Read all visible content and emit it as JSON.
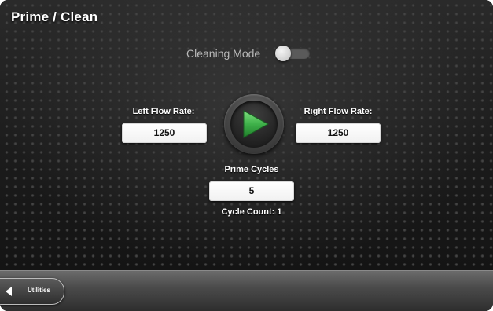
{
  "header": {
    "title": "Prime / Clean"
  },
  "cleaning_mode": {
    "label": "Cleaning Mode",
    "enabled": false
  },
  "left_flow": {
    "label": "Left Flow Rate:",
    "value": "1250"
  },
  "right_flow": {
    "label": "Right Flow Rate:",
    "value": "1250"
  },
  "prime": {
    "label": "Prime Cycles",
    "value": "5",
    "cycle_count": "Cycle Count: 1"
  },
  "play_button": {
    "icon": "play-icon",
    "color": "#3fb14a"
  },
  "bottom_nav": {
    "back_label": "Utilities",
    "icon": "back-arrow-icon"
  }
}
